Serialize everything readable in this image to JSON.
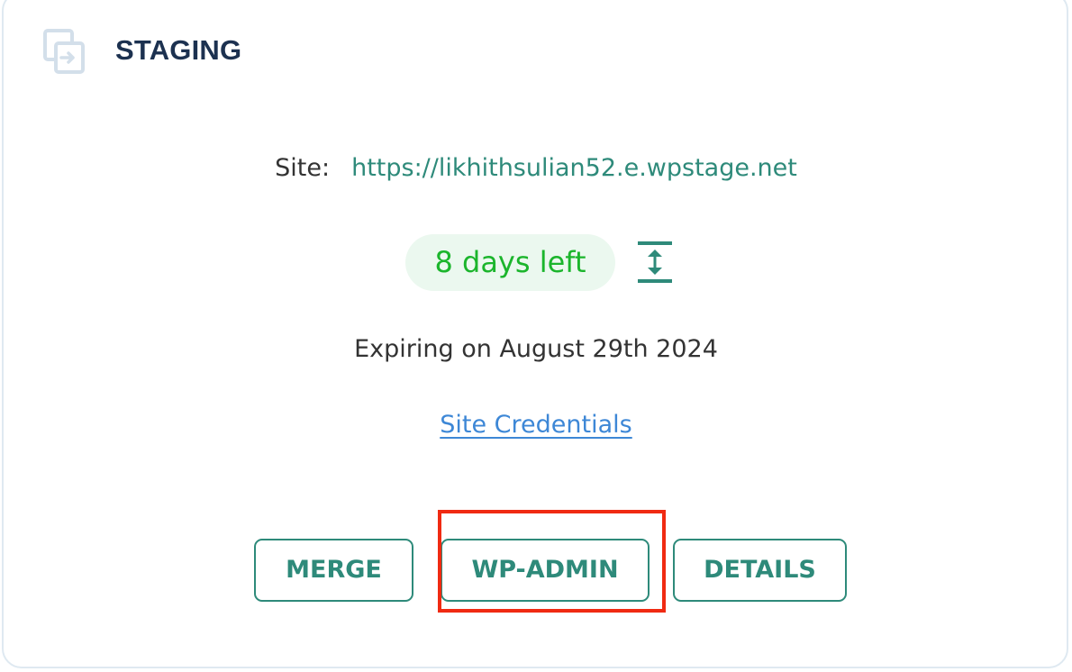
{
  "header": {
    "icon": "staging-copy-icon",
    "title": "STAGING"
  },
  "site": {
    "label": "Site:",
    "url": "https://likhithsulian52.e.wpstage.net"
  },
  "expiry": {
    "days_left": "8 days left",
    "extend_icon": "vertical-expand-icon",
    "expiring_text": "Expiring on August 29th 2024"
  },
  "links": {
    "credentials": "Site Credentials"
  },
  "actions": {
    "merge": "MERGE",
    "wp_admin": "WP-ADMIN",
    "details": "DETAILS"
  },
  "colors": {
    "title": "#1c3150",
    "accent": "#2e8a7a",
    "days_left_text": "#1bb52c",
    "days_left_bg": "#ebf8ef",
    "link": "#3d87d6",
    "highlight": "#f02a12"
  }
}
